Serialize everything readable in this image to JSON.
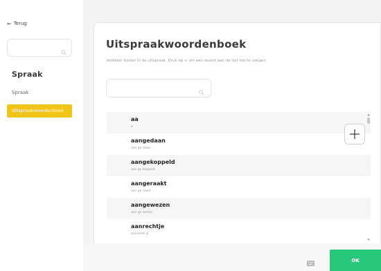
{
  "sidebar": {
    "back_label": "Terug",
    "search_placeholder": "",
    "heading": "Spraak",
    "items": [
      {
        "label": "Spraak",
        "active": false
      },
      {
        "label": "Uitspraakwoordenboek",
        "active": true
      }
    ]
  },
  "main": {
    "title": "Uitspraakwoordenboek",
    "subtitle": "Verbeter fouten in de uitspraak. Druk op + om een woord aan de lijst toe te voegen",
    "search_placeholder": "",
    "entries": [
      {
        "word": "aa",
        "pronunciation": "a"
      },
      {
        "word": "aangedaan",
        "pronunciation": "aan ge daan"
      },
      {
        "word": "aangekoppeld",
        "pronunciation": "aan ge koppeld"
      },
      {
        "word": "aangeraakt",
        "pronunciation": "aan ge raakt"
      },
      {
        "word": "aangewezen",
        "pronunciation": "aan ge wezen"
      },
      {
        "word": "aanrechtje",
        "pronunciation": "aanrecht je"
      }
    ]
  },
  "footer": {
    "ok_label": "OK"
  },
  "icons": {
    "back": "arrow-left-icon",
    "search": "search-icon",
    "add": "plus-icon",
    "keyboard": "keyboard-icon"
  },
  "colors": {
    "active_item": "#f2c318",
    "ok_button": "#28c77a"
  }
}
